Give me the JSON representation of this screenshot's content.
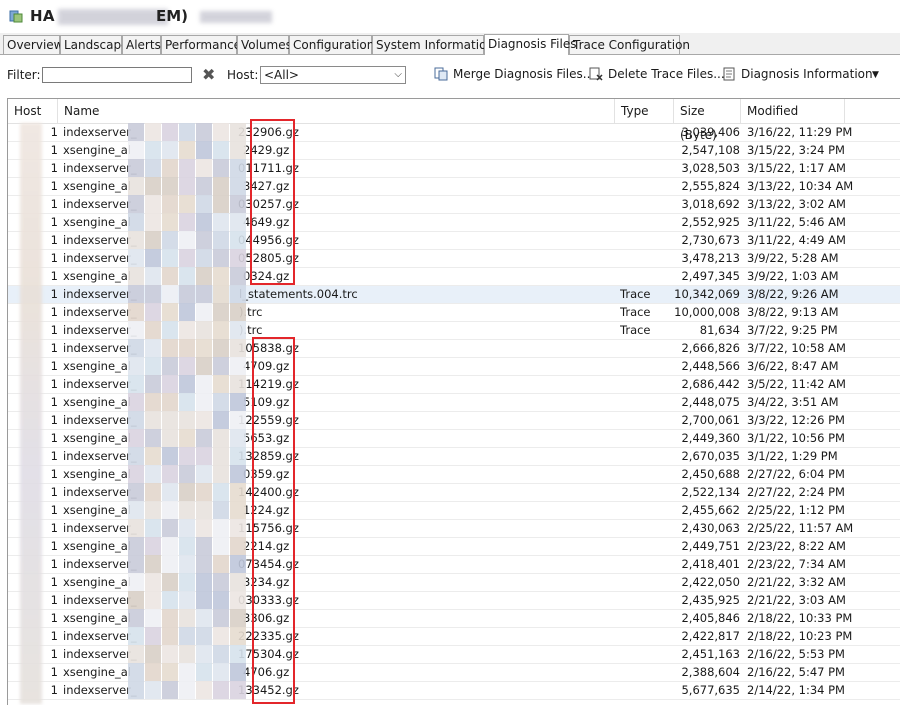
{
  "window": {
    "title": "HA"
  },
  "tabs": [
    {
      "label": "Overview",
      "active": false
    },
    {
      "label": "Landscape",
      "active": false
    },
    {
      "label": "Alerts",
      "active": false
    },
    {
      "label": "Performance",
      "active": false
    },
    {
      "label": "Volumes",
      "active": false
    },
    {
      "label": "Configuration",
      "active": false
    },
    {
      "label": "System Information",
      "active": false
    },
    {
      "label": "Diagnosis Files",
      "active": true
    },
    {
      "label": "Trace Configuration",
      "active": false
    }
  ],
  "toolbar": {
    "filter_label": "Filter:",
    "filter_value": "",
    "host_label": "Host:",
    "host_selected": "<All>",
    "merge_label": "Merge Diagnosis Files...",
    "delete_label": "Delete Trace Files...",
    "diag_label": "Diagnosis Information"
  },
  "table": {
    "columns": {
      "host": "Host",
      "name": "Name",
      "type": "Type",
      "size": "Size (Byte)",
      "modified": "Modified"
    },
    "rows": [
      {
        "host": "1",
        "prefix": "indexserver_",
        "suffix": "232906.gz",
        "type": "",
        "size": "3,039,406",
        "modified": "3/16/22, 11:29 PM"
      },
      {
        "host": "1",
        "prefix": "xsengine_al",
        "suffix": "2429.gz",
        "type": "",
        "size": "2,547,108",
        "modified": "3/15/22, 3:24 PM"
      },
      {
        "host": "1",
        "prefix": "indexserver_",
        "suffix": "011711.gz",
        "type": "",
        "size": "3,028,503",
        "modified": "3/15/22, 1:17 AM"
      },
      {
        "host": "1",
        "prefix": "xsengine_al",
        "suffix": "3427.gz",
        "type": "",
        "size": "2,555,824",
        "modified": "3/13/22, 10:34 AM"
      },
      {
        "host": "1",
        "prefix": "indexserver_",
        "suffix": "030257.gz",
        "type": "",
        "size": "3,018,692",
        "modified": "3/13/22, 3:02 AM"
      },
      {
        "host": "1",
        "prefix": "xsengine_al",
        "suffix": "4649.gz",
        "type": "",
        "size": "2,552,925",
        "modified": "3/11/22, 5:46 AM"
      },
      {
        "host": "1",
        "prefix": "indexserver_",
        "suffix": "044956.gz",
        "type": "",
        "size": "2,730,673",
        "modified": "3/11/22, 4:49 AM"
      },
      {
        "host": "1",
        "prefix": "indexserver_",
        "suffix": "052805.gz",
        "type": "",
        "size": "3,478,213",
        "modified": "3/9/22, 5:28 AM"
      },
      {
        "host": "1",
        "prefix": "xsengine_al",
        "suffix": "0324.gz",
        "type": "",
        "size": "2,497,345",
        "modified": "3/9/22, 1:03 AM"
      },
      {
        "host": "1",
        "prefix": "indexserver_",
        "suffix": "l_statements.004.trc",
        "type": "Trace",
        "size": "10,342,069",
        "modified": "3/8/22, 9:26 AM",
        "selected": true
      },
      {
        "host": "1",
        "prefix": "indexserver_",
        "suffix": ").trc",
        "type": "Trace",
        "size": "10,000,008",
        "modified": "3/8/22, 9:13 AM"
      },
      {
        "host": "1",
        "prefix": "indexserver_",
        "suffix": ").trc",
        "type": "Trace",
        "size": "81,634",
        "modified": "3/7/22, 9:25 PM"
      },
      {
        "host": "1",
        "prefix": "indexserver_",
        "suffix": "105838.gz",
        "type": "",
        "size": "2,666,826",
        "modified": "3/7/22, 10:58 AM"
      },
      {
        "host": "1",
        "prefix": "xsengine_al",
        "suffix": "4709.gz",
        "type": "",
        "size": "2,448,566",
        "modified": "3/6/22, 8:47 AM"
      },
      {
        "host": "1",
        "prefix": "indexserver_",
        "suffix": "114219.gz",
        "type": "",
        "size": "2,686,442",
        "modified": "3/5/22, 11:42 AM"
      },
      {
        "host": "1",
        "prefix": "xsengine_al",
        "suffix": "5109.gz",
        "type": "",
        "size": "2,448,075",
        "modified": "3/4/22, 3:51 AM"
      },
      {
        "host": "1",
        "prefix": "indexserver_",
        "suffix": "122559.gz",
        "type": "",
        "size": "2,700,061",
        "modified": "3/3/22, 12:26 PM"
      },
      {
        "host": "1",
        "prefix": "xsengine_al",
        "suffix": "5653.gz",
        "type": "",
        "size": "2,449,360",
        "modified": "3/1/22, 10:56 PM"
      },
      {
        "host": "1",
        "prefix": "indexserver_",
        "suffix": "132859.gz",
        "type": "",
        "size": "2,670,035",
        "modified": "3/1/22, 1:29 PM"
      },
      {
        "host": "1",
        "prefix": "xsengine_al",
        "suffix": "0359.gz",
        "type": "",
        "size": "2,450,688",
        "modified": "2/27/22, 6:04 PM"
      },
      {
        "host": "1",
        "prefix": "indexserver_",
        "suffix": "142400.gz",
        "type": "",
        "size": "2,522,134",
        "modified": "2/27/22, 2:24 PM"
      },
      {
        "host": "1",
        "prefix": "xsengine_al",
        "suffix": "1224.gz",
        "type": "",
        "size": "2,455,662",
        "modified": "2/25/22, 1:12 PM"
      },
      {
        "host": "1",
        "prefix": "indexserver_",
        "suffix": "115756.gz",
        "type": "",
        "size": "2,430,063",
        "modified": "2/25/22, 11:57 AM"
      },
      {
        "host": "1",
        "prefix": "xsengine_al",
        "suffix": "2214.gz",
        "type": "",
        "size": "2,449,751",
        "modified": "2/23/22, 8:22 AM"
      },
      {
        "host": "1",
        "prefix": "indexserver_",
        "suffix": "073454.gz",
        "type": "",
        "size": "2,418,401",
        "modified": "2/23/22, 7:34 AM"
      },
      {
        "host": "1",
        "prefix": "xsengine_al",
        "suffix": "3234.gz",
        "type": "",
        "size": "2,422,050",
        "modified": "2/21/22, 3:32 AM"
      },
      {
        "host": "1",
        "prefix": "indexserver_",
        "suffix": "030333.gz",
        "type": "",
        "size": "2,435,925",
        "modified": "2/21/22, 3:03 AM"
      },
      {
        "host": "1",
        "prefix": "xsengine_al",
        "suffix": "3306.gz",
        "type": "",
        "size": "2,405,846",
        "modified": "2/18/22, 10:33 PM"
      },
      {
        "host": "1",
        "prefix": "indexserver_",
        "suffix": "222335.gz",
        "type": "",
        "size": "2,422,817",
        "modified": "2/18/22, 10:23 PM"
      },
      {
        "host": "1",
        "prefix": "indexserver_",
        "suffix": "175304.gz",
        "type": "",
        "size": "2,451,163",
        "modified": "2/16/22, 5:53 PM"
      },
      {
        "host": "1",
        "prefix": "xsengine_al",
        "suffix": "4706.gz",
        "type": "",
        "size": "2,388,604",
        "modified": "2/16/22, 5:47 PM"
      },
      {
        "host": "1",
        "prefix": "indexserver_",
        "suffix": "133452.gz",
        "type": "",
        "size": "5,677,635",
        "modified": "2/14/22, 1:34 PM"
      }
    ]
  },
  "colors": {
    "highlight_box": "#e3262b",
    "selected_row": "#e8f0f9",
    "tab_bar": "#f0f0f0"
  },
  "icons": {
    "app": "database-icon",
    "clear": "close-icon",
    "merge": "merge-files-icon",
    "delete": "delete-file-icon",
    "diag": "diagnosis-info-icon"
  }
}
